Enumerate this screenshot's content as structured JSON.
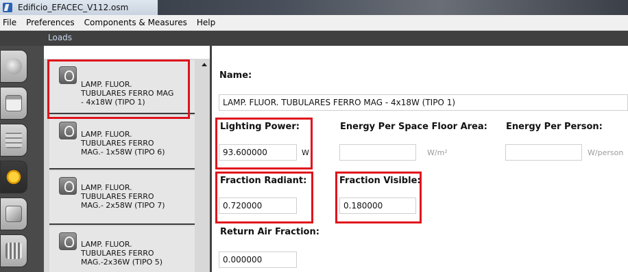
{
  "window": {
    "title": "Edificio_EFACEC_V112.osm"
  },
  "menu": {
    "items": [
      "File",
      "Preferences",
      "Components & Measures",
      "Help"
    ]
  },
  "section": {
    "title": "Loads"
  },
  "loads": {
    "items": [
      {
        "label": "LAMP. FLUOR.\nTUBULARES FERRO MAG\n- 4x18W (TIPO 1)",
        "selected": true
      },
      {
        "label": "LAMP. FLUOR.\nTUBULARES FERRO\nMAG.- 1x58W (TIPO 6)",
        "selected": false
      },
      {
        "label": "LAMP. FLUOR.\nTUBULARES FERRO\nMAG.- 2x58W (TIPO 7)",
        "selected": false
      },
      {
        "label": "LAMP. FLUOR.\nTUBULARES FERRO\nMAG.-2x36W (TIPO 5)",
        "selected": false
      }
    ]
  },
  "props": {
    "name_label": "Name:",
    "name_value": "LAMP. FLUOR. TUBULARES FERRO MAG - 4x18W (TIPO 1)",
    "lighting_power_label": "Lighting Power:",
    "lighting_power_value": "93.600000",
    "lighting_power_unit": "W",
    "energy_area_label": "Energy Per Space Floor Area:",
    "energy_area_value": "",
    "energy_area_unit": "W/m²",
    "energy_person_label": "Energy Per Person:",
    "energy_person_value": "",
    "energy_person_unit": "W/person",
    "fraction_radiant_label": "Fraction Radiant:",
    "fraction_radiant_value": "0.720000",
    "fraction_visible_label": "Fraction Visible:",
    "fraction_visible_value": "0.180000",
    "return_air_label": "Return Air Fraction:",
    "return_air_value": "0.000000"
  },
  "colors": {
    "highlight": "#e0121b",
    "dark": "#404040",
    "loads_label": "#c8d7ef"
  }
}
